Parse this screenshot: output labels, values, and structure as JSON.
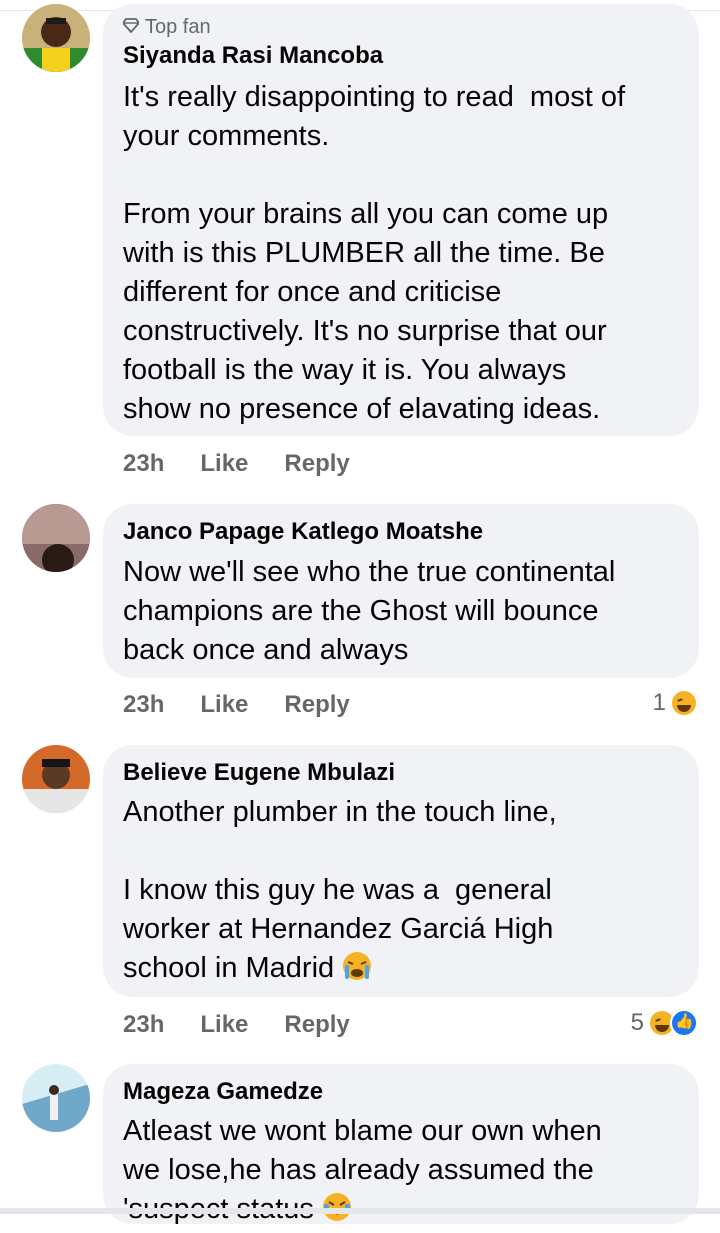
{
  "comments": [
    {
      "badge": "Top fan",
      "author": "Siyanda Rasi Mancoba",
      "text": "It's really disappointing to read  most of\nyour comments.\n\nFrom your brains all you can come up\nwith is this PLUMBER all the time. Be\ndifferent for once and criticise\nconstructively. It's no surprise that our\nfootball is the way it is. You always\nshow no presence of elavating ideas.",
      "time": "23h",
      "like": "Like",
      "reply": "Reply"
    },
    {
      "author": "Janco Papage Katlego Moatshe",
      "text": "Now we'll see who the true continental\nchampions are the Ghost will bounce\nback once and always",
      "time": "23h",
      "like": "Like",
      "reply": "Reply",
      "reaction_count": "1",
      "reaction_icons": [
        "haha-icon"
      ]
    },
    {
      "author": "Believe Eugene Mbulazi",
      "text": "Another plumber in the touch line,\n\nI know this guy he was a  general\nworker at Hernandez Garciá High\nschool in Madrid",
      "text_emoji": "crying-face-icon",
      "time": "23h",
      "like": "Like",
      "reply": "Reply",
      "reaction_count": "5",
      "reaction_icons": [
        "haha-icon",
        "like-icon"
      ]
    },
    {
      "author": "Mageza Gamedze",
      "text": "Atleast we wont blame our own when\nwe lose,he has already assumed the\n'suspect status",
      "text_emoji": "laughing-face-icon"
    }
  ],
  "colors": {
    "bubble": "#f0f2f5",
    "meta": "#65676b",
    "text": "#050505",
    "like_blue": "#1877f2",
    "haha_yellow": "#f7b125"
  }
}
